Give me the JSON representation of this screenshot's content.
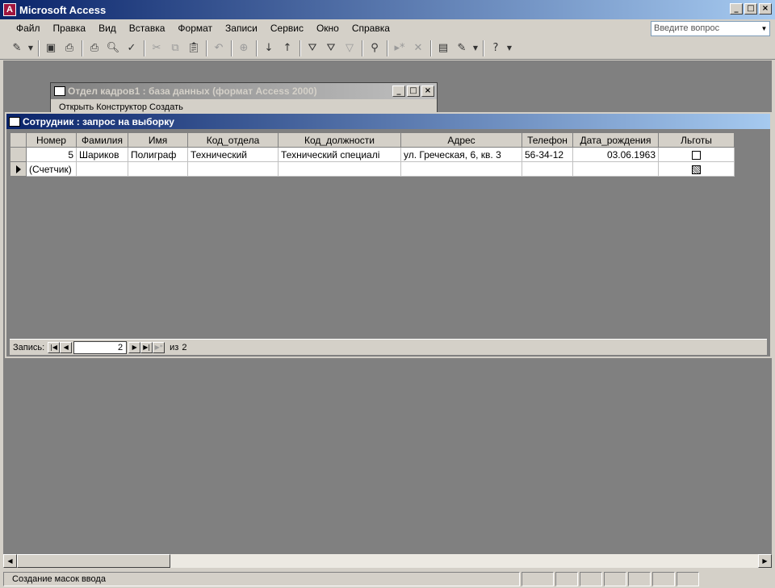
{
  "app": {
    "title": "Microsoft Access"
  },
  "menu": [
    "Файл",
    "Правка",
    "Вид",
    "Вставка",
    "Формат",
    "Записи",
    "Сервис",
    "Окно",
    "Справка"
  ],
  "help_search": {
    "placeholder": "Введите вопрос"
  },
  "toolbar": {
    "icons": [
      "design-view-icon",
      "save-icon",
      "print-preview-icon",
      "print-icon",
      "preview-icon",
      "spelling-icon",
      "cut-icon",
      "copy-icon",
      "paste-icon",
      "undo-icon",
      "hyperlink-icon",
      "sort-ascending-icon",
      "sort-descending-icon",
      "filter-by-selection-icon",
      "filter-by-form-icon",
      "apply-filter-icon",
      "find-icon",
      "new-record-icon",
      "delete-record-icon",
      "database-window-icon",
      "new-object-icon",
      "help-icon"
    ]
  },
  "db_window": {
    "title": "Отдел кадров1 : база данных (формат Access 2000)",
    "toolbar_text": "Открыть   Конструктор   Создать"
  },
  "query_window": {
    "title": "Сотрудник : запрос на выборку",
    "columns": [
      "Номер",
      "Фамилия",
      "Имя",
      "Код_отдела",
      "Код_должности",
      "Адрес",
      "Телефон",
      "Дата_рождения",
      "Льготы"
    ],
    "row1": {
      "Номер": "5",
      "Фамилия": "Шариков",
      "Имя": "Полиграф",
      "Код_отдела": "Технический",
      "Код_должности": "Технический специалі",
      "Адрес": "ул. Греческая, 6, кв. 3",
      "Телефон": "56-34-12",
      "Дата_рождения": "03.06.1963",
      "Льготы": false
    },
    "new_row": {
      "Номер": "(Счетчик)"
    }
  },
  "navigation": {
    "label": "Запись:",
    "current": "2",
    "of_label": "из",
    "total": "2"
  },
  "status": {
    "text": "Создание масок ввода"
  }
}
